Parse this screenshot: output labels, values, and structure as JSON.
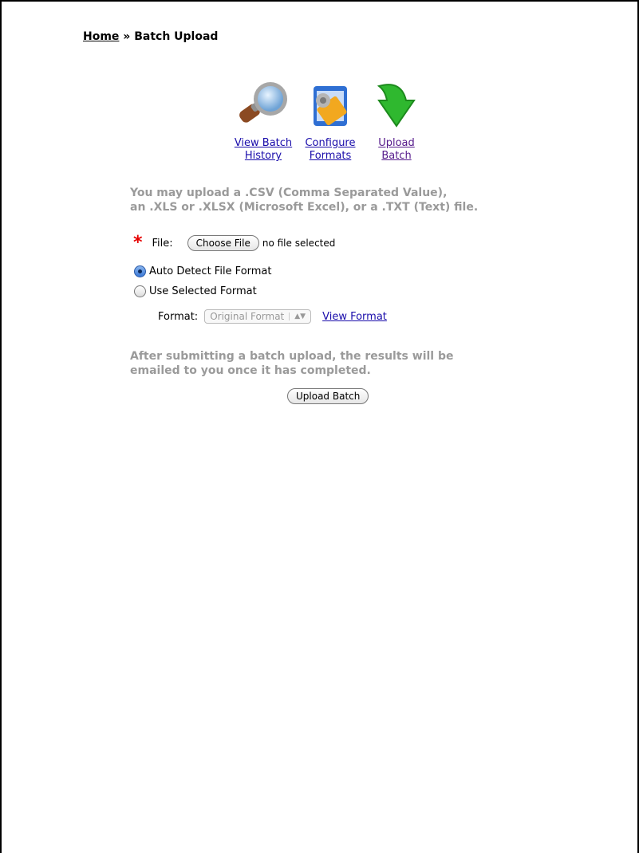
{
  "breadcrumb": {
    "home": "Home",
    "separator": "»",
    "current": "Batch Upload"
  },
  "tools": [
    {
      "label": "View Batch\nHistory",
      "icon": "magnifier-icon"
    },
    {
      "label": "Configure\nFormats",
      "icon": "configure-icon"
    },
    {
      "label": "Upload\nBatch",
      "icon": "upload-arrow-icon"
    }
  ],
  "intro": {
    "line1": "You may upload a .CSV (Comma Separated Value),",
    "line2": "an .XLS or .XLSX (Microsoft Excel), or a .TXT (Text) file."
  },
  "file": {
    "required_marker": "*",
    "label": "File:",
    "choose_button": "Choose File",
    "status": "no file selected"
  },
  "options": {
    "auto": "Auto Detect File Format",
    "selected": "Use Selected Format",
    "auto_checked": true
  },
  "format": {
    "label": "Format:",
    "select_value": "Original Format",
    "view_link": "View Format"
  },
  "note": {
    "line1": "After submitting a batch upload, the results will be",
    "line2": "emailed to you once it has completed."
  },
  "submit": {
    "label": "Upload Batch"
  },
  "colors": {
    "link": "#1a0dab",
    "visited": "#551a8b",
    "required": "#e60000",
    "muted_text": "#9a9a9a"
  }
}
